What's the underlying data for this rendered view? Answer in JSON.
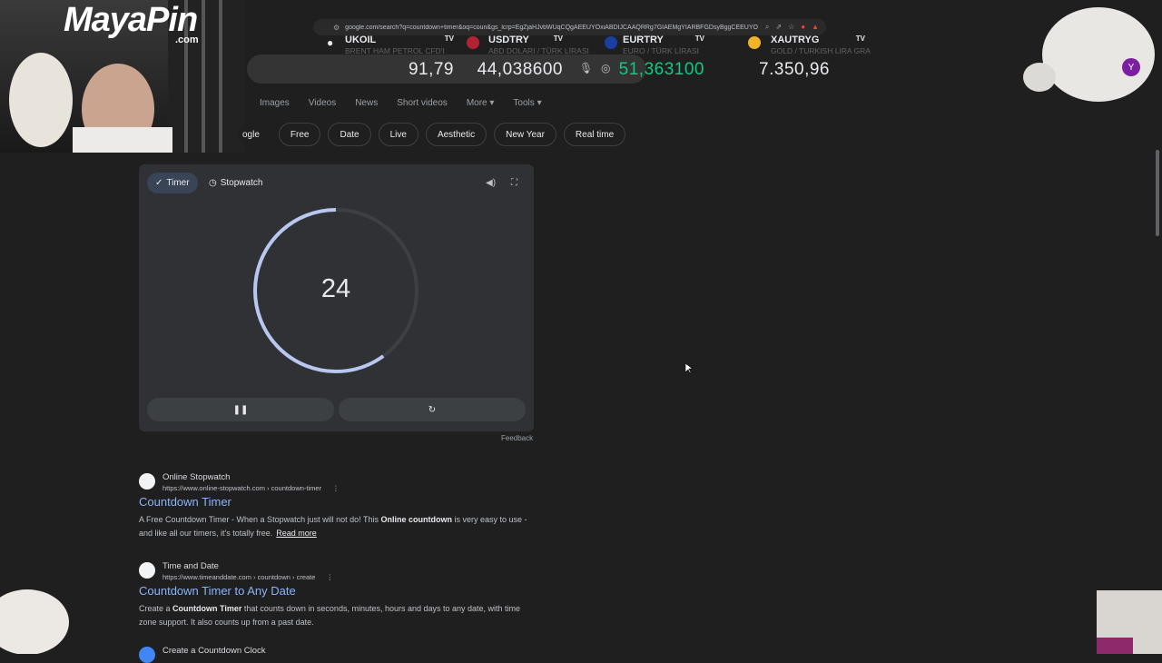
{
  "browser": {
    "url": "google.com/search?q=countdown+timer&oq=coun&gs_lcrp=EgZjaHJvbWUqCQgAEEUYOxiABDIJCAAQRRg7GIAEMgYIARBFGDsyBggCEEUYOTI..."
  },
  "ticker": [
    {
      "symbol": "UKOIL",
      "sub": "BRENT HAM PETROL CFD'I",
      "price": "91,79",
      "color": "#e8eaed"
    },
    {
      "symbol": "USDTRY",
      "sub": "ABD DOLARI / TÜRK LİRASI",
      "price": "44,038600",
      "color": "#e8eaed"
    },
    {
      "symbol": "EURTRY",
      "sub": "EURO / TÜRK LİRASI",
      "price": "51,363100",
      "color": "#0ecb81"
    },
    {
      "symbol": "XAUTRYG",
      "sub": "GOLD / TURKISH LIRA GRA",
      "price": "7.350,96",
      "color": "#e8eaed"
    }
  ],
  "ticker_badge": "TV",
  "tabs": [
    "Images",
    "Videos",
    "News",
    "Short videos",
    "More",
    "Tools"
  ],
  "chips": [
    "ogle",
    "Free",
    "Date",
    "Live",
    "Aesthetic",
    "New Year",
    "Real time"
  ],
  "timer": {
    "tab_timer": "Timer",
    "tab_stopwatch": "Stopwatch",
    "count": "24",
    "progress": 0.4,
    "feedback": "Feedback"
  },
  "results": [
    {
      "site": "Online Stopwatch",
      "url": "https://www.online-stopwatch.com › countdown-timer",
      "title": "Countdown Timer",
      "snippet_a": "A Free Countdown Timer - When a Stopwatch just will not do! This ",
      "snippet_bold": "Online countdown",
      "snippet_b": " is very easy to use - and like all our timers, it's totally free.",
      "read_more": "Read more"
    },
    {
      "site": "Time and Date",
      "url": "https://www.timeanddate.com › countdown › create",
      "title": "Countdown Timer to Any Date",
      "snippet_a": "Create a ",
      "snippet_bold": "Countdown Timer",
      "snippet_b": " that counts down in seconds, minutes, hours and days to any date, with time zone support. It also counts up from a past date."
    },
    {
      "title": "Create a Countdown Clock"
    }
  ],
  "overlay": {
    "logo": "MayaPin",
    "logo_domain": ".com",
    "avatar_letter": "Y"
  }
}
